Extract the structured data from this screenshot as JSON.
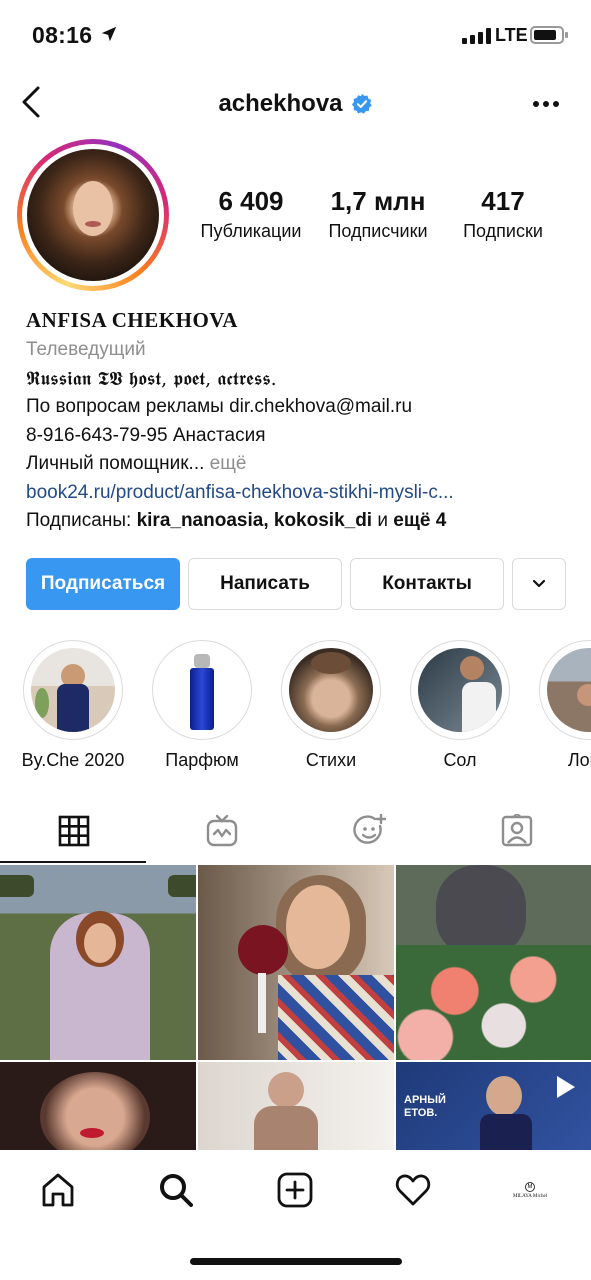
{
  "status_bar": {
    "time": "08:16",
    "network": "LTE"
  },
  "header": {
    "username": "achekhova",
    "verified": true
  },
  "stats": [
    {
      "value": "6 409",
      "label": "Публикации"
    },
    {
      "value": "1,7 млн",
      "label": "Подписчики"
    },
    {
      "value": "417",
      "label": "Подписки"
    }
  ],
  "bio": {
    "name": "ANFISA CHEKHOVA",
    "category": "Телеведущий",
    "line1": "𝕽𝖚𝖘𝖘𝖎𝖆𝖓 𝕿𝖁 𝖍𝖔𝖘𝖙, 𝖕𝖔𝖊𝖙, 𝖆𝖈𝖙𝖗𝖊𝖘𝖘.",
    "line2": "По вопросам рекламы dir.chekhova@mail.ru",
    "line3": "8-916-643-79-95 Анастасия",
    "line4": "Личный помощник...",
    "more": " ещё",
    "link": "book24.ru/product/anfisa-chekhova-stikhi-mysli-c...",
    "followed_by_prefix": "Подписаны: ",
    "followed_by_users": "kira_nanoasia, kokosik_di",
    "followed_by_and": " и ",
    "followed_by_more": "ещё 4"
  },
  "actions": {
    "follow": "Подписаться",
    "message": "Написать",
    "contacts": "Контакты"
  },
  "highlights": [
    {
      "label": "By.Che 2020"
    },
    {
      "label": "Парфюм"
    },
    {
      "label": "Стихи"
    },
    {
      "label": "Сол"
    },
    {
      "label": "Лонд"
    }
  ],
  "tabs": [
    "grid-icon",
    "igtv-icon",
    "reels-icon",
    "tagged-icon"
  ],
  "grid_overlay_text": "АРНЫЙ\nЕТОВ.",
  "bottom_nav": [
    "home-icon",
    "search-icon",
    "add-icon",
    "heart-icon",
    "profile-avatar"
  ],
  "profile_avatar_text": "MILAYA Michel",
  "colors": {
    "primary": "#3897f0",
    "link": "#234a87",
    "muted": "#8e8e8e",
    "verified": "#3897f0"
  }
}
